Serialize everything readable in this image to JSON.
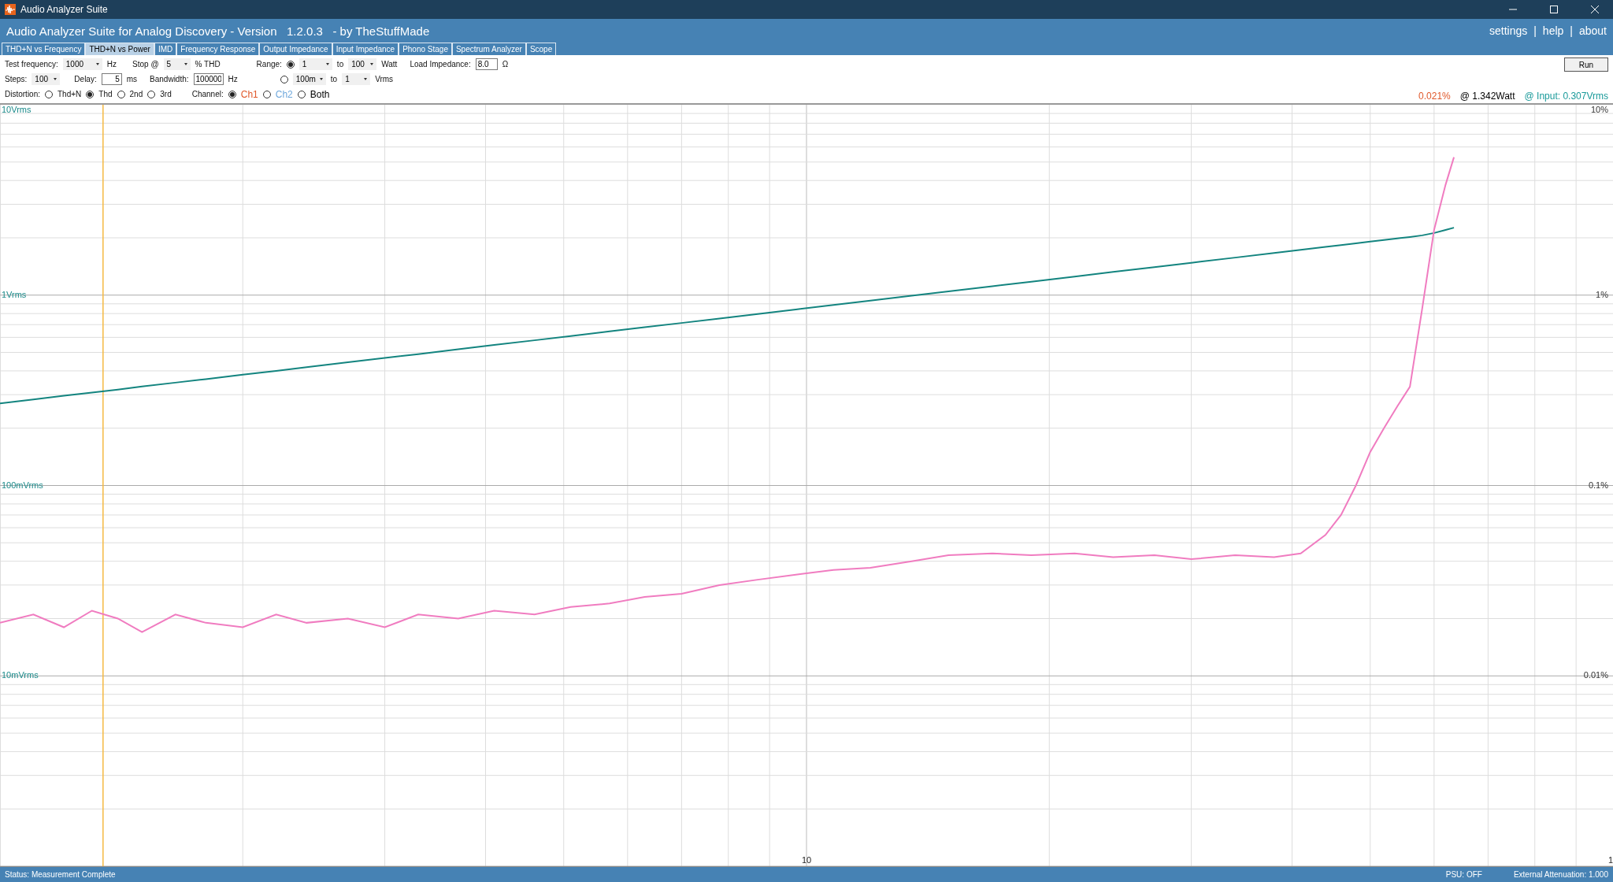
{
  "window": {
    "title": "Audio Analyzer Suite"
  },
  "header": {
    "title": "Audio Analyzer Suite for Analog Discovery - Version   1.2.0.3   - by TheStuffMade",
    "links": [
      "settings",
      "help",
      "about"
    ],
    "separator": "|"
  },
  "tabs": [
    {
      "label": "THD+N vs Frequency",
      "selected": false
    },
    {
      "label": "THD+N vs Power",
      "selected": true
    },
    {
      "label": "IMD",
      "selected": false
    },
    {
      "label": "Frequency Response",
      "selected": false
    },
    {
      "label": "Output Impedance",
      "selected": false
    },
    {
      "label": "Input Impedance",
      "selected": false
    },
    {
      "label": "Phono Stage",
      "selected": false
    },
    {
      "label": "Spectrum Analyzer",
      "selected": false
    },
    {
      "label": "Scope",
      "selected": false
    }
  ],
  "controls": {
    "test_frequency": {
      "label": "Test frequency:",
      "value": "1000",
      "unit": "Hz"
    },
    "stop": {
      "label": "Stop @",
      "value": "5",
      "unit": "% THD"
    },
    "steps": {
      "label": "Steps:",
      "value": "100"
    },
    "delay": {
      "label": "Delay:",
      "value": "5",
      "unit": "ms"
    },
    "bandwidth": {
      "label": "Bandwidth:",
      "value": "100000",
      "unit": "Hz"
    },
    "range": {
      "label": "Range:",
      "options": [
        {
          "selected": true,
          "from": "1",
          "to_label": "to",
          "to": "100",
          "unit": "Watt"
        },
        {
          "selected": false,
          "from": "100m",
          "to_label": "to",
          "to": "1",
          "unit": "Vrms"
        }
      ]
    },
    "load_impedance": {
      "label": "Load Impedance:",
      "value": "8.0",
      "unit": "Ω"
    },
    "distortion": {
      "label": "Distortion:",
      "options": [
        {
          "label": "Thd+N",
          "selected": false
        },
        {
          "label": "Thd",
          "selected": true
        },
        {
          "label": "2nd",
          "selected": false
        },
        {
          "label": "3rd",
          "selected": false
        }
      ]
    },
    "channel": {
      "label": "Channel:",
      "options": [
        {
          "label": "Ch1",
          "selected": true,
          "color": "#e0582a"
        },
        {
          "label": "Ch2",
          "selected": false,
          "color": "#6fa8dc"
        },
        {
          "label": "Both",
          "selected": false,
          "color": "#000000"
        }
      ]
    },
    "run_button": "Run"
  },
  "readouts": [
    {
      "text": "0.021%",
      "color": "#e0582a"
    },
    {
      "text": "@ 1.342Watt",
      "color": "#000000"
    },
    {
      "text": "@ Input: 0.307Vrms",
      "color": "#1a9a9a"
    }
  ],
  "chart": {
    "left_axis_labels": [
      "10Vrms",
      "1Vrms",
      "100mVrms",
      "10mVrms"
    ],
    "right_axis_labels": [
      "10%",
      "1%",
      "0.1%",
      "0.01%"
    ],
    "x_axis_labels": [
      "10",
      "1"
    ]
  },
  "status_bar": {
    "status": "Status: Measurement Complete",
    "psu": "PSU: OFF",
    "attenuation": "External Attenuation: 1.000"
  }
}
